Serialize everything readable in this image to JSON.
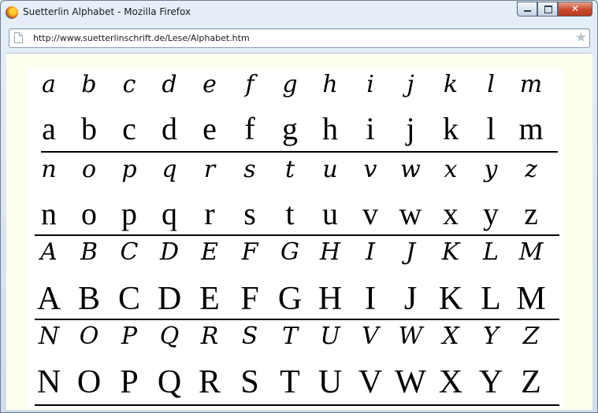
{
  "window": {
    "title": "Suetterlin Alphabet - Mozilla Firefox",
    "controls": {
      "minimize": "–",
      "maximize": "□",
      "close": "✕"
    }
  },
  "navbar": {
    "url": "http://www.suetterlinschrift.de/Lese/Alphabet.htm",
    "bookmark_icon": "★"
  },
  "alphabet": {
    "rows": [
      {
        "kind": "script-lower",
        "glyphs": [
          "a",
          "b",
          "c",
          "d",
          "e",
          "f",
          "g",
          "h",
          "i",
          "j",
          "k",
          "l",
          "m"
        ]
      },
      {
        "kind": "latin-lower",
        "glyphs": [
          "a",
          "b",
          "c",
          "d",
          "e",
          "f",
          "g",
          "h",
          "i",
          "j",
          "k",
          "l",
          "m"
        ]
      },
      {
        "kind": "script-lower",
        "glyphs": [
          "n",
          "o",
          "p",
          "q",
          "r",
          "s",
          "t",
          "u",
          "v",
          "w",
          "x",
          "y",
          "z"
        ]
      },
      {
        "kind": "latin-lower",
        "glyphs": [
          "n",
          "o",
          "p",
          "q",
          "r",
          "s",
          "t",
          "u",
          "v",
          "w",
          "x",
          "y",
          "z"
        ]
      },
      {
        "kind": "script-upper",
        "glyphs": [
          "A",
          "B",
          "C",
          "D",
          "E",
          "F",
          "G",
          "H",
          "I",
          "J",
          "K",
          "L",
          "M"
        ]
      },
      {
        "kind": "latin-upper",
        "glyphs": [
          "A",
          "B",
          "C",
          "D",
          "E",
          "F",
          "G",
          "H",
          "I",
          "J",
          "K",
          "L",
          "M"
        ]
      },
      {
        "kind": "script-upper",
        "glyphs": [
          "N",
          "O",
          "P",
          "Q",
          "R",
          "S",
          "T",
          "U",
          "V",
          "W",
          "X",
          "Y",
          "Z"
        ]
      },
      {
        "kind": "latin-upper",
        "glyphs": [
          "N",
          "O",
          "P",
          "Q",
          "R",
          "S",
          "T",
          "U",
          "V",
          "W",
          "X",
          "Y",
          "Z"
        ]
      }
    ]
  }
}
